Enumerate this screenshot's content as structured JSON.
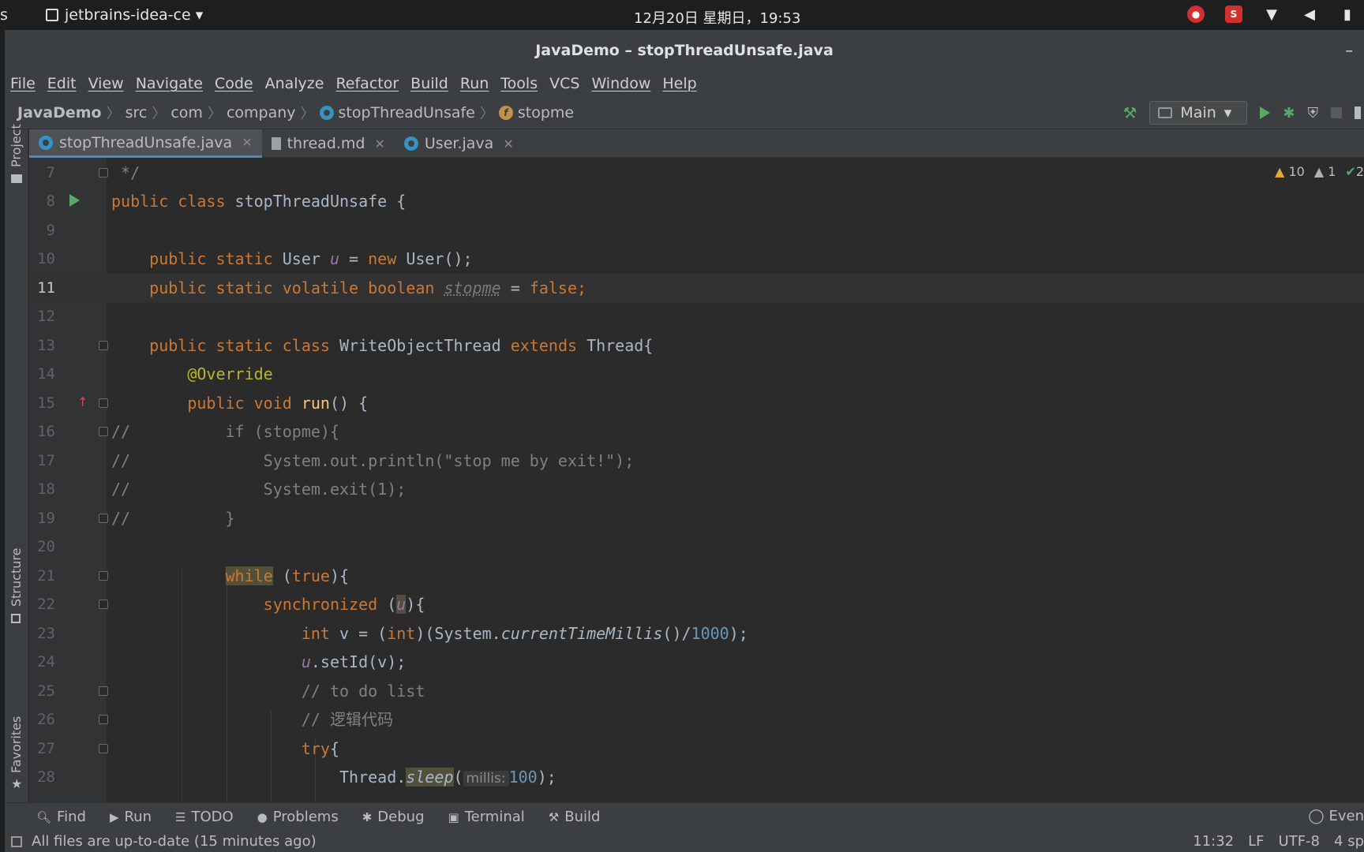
{
  "system_bar": {
    "left_char": "s",
    "app_name": "jetbrains-idea-ce ▾",
    "clock": "12月20日 星期日，19:53"
  },
  "window": {
    "title": "JavaDemo – stopThreadUnsafe.java",
    "minimize": "–"
  },
  "menu": [
    "File",
    "Edit",
    "View",
    "Navigate",
    "Code",
    "Analyze",
    "Refactor",
    "Build",
    "Run",
    "Tools",
    "VCS",
    "Window",
    "Help"
  ],
  "breadcrumb": [
    "JavaDemo",
    "src",
    "com",
    "company",
    "stopThreadUnsafe",
    "stopme"
  ],
  "run_config": {
    "label": "Main",
    "caret": "▾"
  },
  "left_stripe": {
    "project": "Project",
    "structure": "Structure",
    "favorites": "Favorites"
  },
  "tabs": [
    {
      "label": "stopThreadUnsafe.java",
      "active": true
    },
    {
      "label": "thread.md",
      "active": false
    },
    {
      "label": "User.java",
      "active": false
    }
  ],
  "inspections": {
    "warnings": "10",
    "weak_warnings": "1",
    "typos": "2"
  },
  "editor": {
    "current_line": 11,
    "line_numbers": [
      "7",
      "8",
      "9",
      "10",
      "11",
      "12",
      "13",
      "14",
      "15",
      "16",
      "17",
      "18",
      "19",
      "20",
      "21",
      "22",
      "23",
      "24",
      "25",
      "26",
      "27",
      "28"
    ],
    "lines": {
      "l7": " */",
      "l8_kw": "public class ",
      "l8_rest": "stopThreadUnsafe {",
      "l10_kw": "    public static ",
      "l10_type": "User ",
      "l10_var": "u",
      "l10_eq": " = ",
      "l10_new": "new ",
      "l10_rest": "User();",
      "l11_kw": "    public static volatile boolean ",
      "l11_var": "stopme",
      "l11_eq": " = ",
      "l11_false": "false",
      "l11_semi": ";",
      "l13_kw": "    public static class ",
      "l13_name": "WriteObjectThread ",
      "l13_ext": "extends ",
      "l13_rest": "Thread{",
      "l14_ann": "        @Override",
      "l15_kw": "        public void ",
      "l15_fn": "run",
      "l15_rest": "() {",
      "l16": "//          if (stopme){",
      "l17": "//              System.out.println(\"stop me by exit!\");",
      "l18": "//              System.exit(1);",
      "l19": "//          }",
      "l21_pre": "            ",
      "l21_while": "while",
      "l21_mid": " (",
      "l21_true": "true",
      "l21_rest": "){",
      "l22_kw": "                synchronized ",
      "l22_p": "(",
      "l22_u": "u",
      "l22_rest": "){",
      "l23_int": "                    int ",
      "l23_v": "v = (",
      "l23_int2": "int",
      "l23_sys": ")(System.",
      "l23_method": "currentTimeMillis",
      "l23_div": "()/",
      "l23_num": "1000",
      "l23_end": ");",
      "l24_pre": "                    ",
      "l24_u": "u",
      "l24_rest": ".setId(v);",
      "l25": "                    // to do list",
      "l26": "                    // 逻辑代码",
      "l27_kw": "                    try",
      "l27_rest": "{",
      "l28_pre": "                        Thread.",
      "l28_fn": "sleep",
      "l28_open": "(",
      "l28_hint": "millis:",
      "l28_num": "100",
      "l28_end": ");"
    }
  },
  "bottom_tools": [
    "Find",
    "Run",
    "TODO",
    "Problems",
    "Debug",
    "Terminal",
    "Build"
  ],
  "event_log": "Even",
  "status": {
    "message": "All files are up-to-date (15 minutes ago)",
    "position": "11:32",
    "line_sep": "LF",
    "encoding": "UTF-8",
    "indent": "4 sp"
  }
}
